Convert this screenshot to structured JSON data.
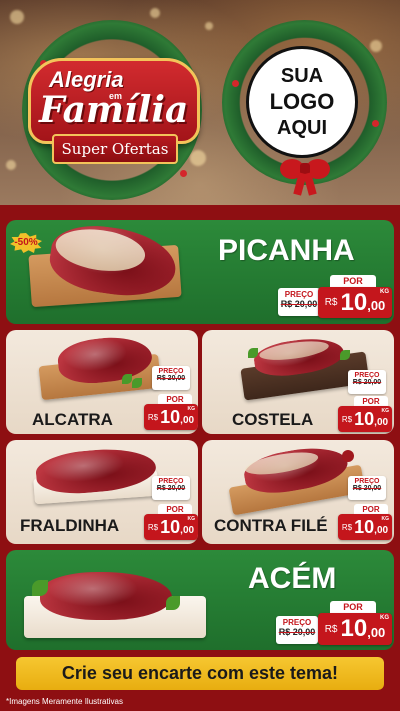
{
  "header": {
    "logo_line1": "Alegria",
    "logo_em": "em",
    "logo_line2": "Família",
    "logo_sub": "Super Ofertas",
    "your_logo": [
      "SUA",
      "LOGO",
      "AQUI"
    ]
  },
  "products": [
    {
      "name": "PICANHA",
      "badge": "-50%",
      "old_label": "PREÇO",
      "old_price": "R$ 20,00",
      "por": "POR",
      "currency": "R$",
      "price_int": "10",
      "price_cents": ",00",
      "unit": "KG"
    },
    {
      "name": "ALCATRA",
      "old_label": "PREÇO",
      "old_price": "R$ 20,00",
      "por": "POR",
      "currency": "R$",
      "price_int": "10",
      "price_cents": ",00",
      "unit": "KG"
    },
    {
      "name": "COSTELA",
      "old_label": "PREÇO",
      "old_price": "R$ 20,00",
      "por": "POR",
      "currency": "R$",
      "price_int": "10",
      "price_cents": ",00",
      "unit": "KG"
    },
    {
      "name": "FRALDINHA",
      "old_label": "PREÇO",
      "old_price": "R$ 20,00",
      "por": "POR",
      "currency": "R$",
      "price_int": "10",
      "price_cents": ",00",
      "unit": "KG"
    },
    {
      "name": "CONTRA FILÉ",
      "old_label": "PREÇO",
      "old_price": "R$ 20,00",
      "por": "POR",
      "currency": "R$",
      "price_int": "10",
      "price_cents": ",00",
      "unit": "KG"
    },
    {
      "name": "ACÉM",
      "old_label": "PREÇO",
      "old_price": "R$ 20,00",
      "por": "POR",
      "currency": "R$",
      "price_int": "10",
      "price_cents": ",00",
      "unit": "KG"
    }
  ],
  "cta": "Crie seu encarte com este tema!",
  "disclaimer": "*Imagens Meramente Ilustrativas",
  "colors": {
    "accent_red": "#c4161c",
    "green": "#2c8a3a",
    "gold": "#f2c029",
    "background": "#8e0f12"
  }
}
